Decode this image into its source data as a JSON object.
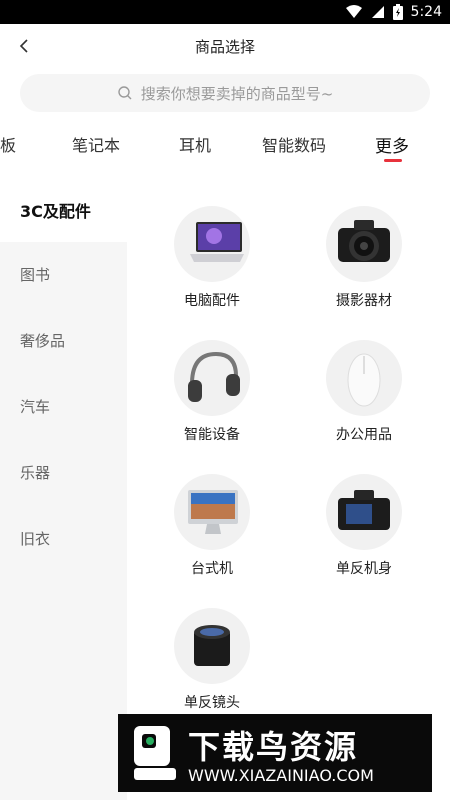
{
  "status_bar": {
    "time": "5:24"
  },
  "header": {
    "title": "商品选择"
  },
  "search": {
    "placeholder": "搜索你想要卖掉的商品型号~"
  },
  "tabs": [
    {
      "label": "板"
    },
    {
      "label": "笔记本"
    },
    {
      "label": "耳机"
    },
    {
      "label": "智能数码"
    },
    {
      "label": "更多",
      "active": true
    }
  ],
  "sidebar": {
    "items": [
      {
        "label": "3C及配件",
        "active": true
      },
      {
        "label": "图书"
      },
      {
        "label": "奢侈品"
      },
      {
        "label": "汽车"
      },
      {
        "label": "乐器"
      },
      {
        "label": "旧衣"
      }
    ]
  },
  "products": [
    {
      "label": "电脑配件",
      "icon": "laptop-icon"
    },
    {
      "label": "摄影器材",
      "icon": "camera-icon"
    },
    {
      "label": "智能设备",
      "icon": "headphones-icon"
    },
    {
      "label": "办公用品",
      "icon": "mouse-icon"
    },
    {
      "label": "台式机",
      "icon": "desktop-icon"
    },
    {
      "label": "单反机身",
      "icon": "dslr-body-icon"
    },
    {
      "label": "单反镜头",
      "icon": "lens-icon"
    }
  ],
  "watermark": {
    "text": "下载鸟资源",
    "url": "WWW.XIAZAINIAO.COM"
  },
  "colors": {
    "accent": "#e8323c",
    "sidebar_bg": "#f6f6f6",
    "search_bg": "#f5f5f5"
  }
}
